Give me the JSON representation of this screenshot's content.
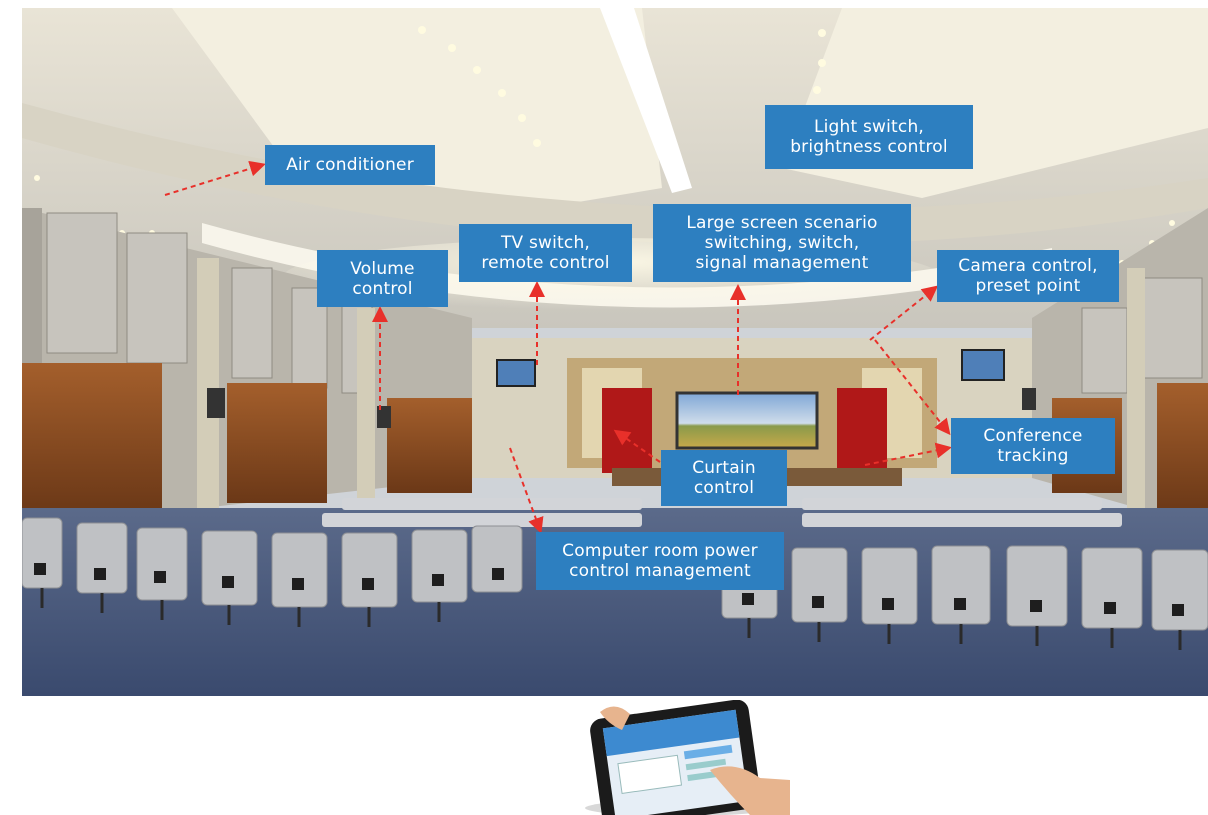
{
  "labels": {
    "air_conditioner": "Air conditioner",
    "light_switch": "Light switch,\nbrightness control",
    "tv_switch": "TV switch,\nremote control",
    "large_screen": "Large screen scenario\nswitching, switch,\nsignal management",
    "volume": "Volume\ncontrol",
    "camera": "Camera control,\npreset point",
    "conference": "Conference\ntracking",
    "curtain": "Curtain\ncontrol",
    "power": "Computer room power\ncontrol management"
  },
  "colors": {
    "label_bg": "#2d7fc0",
    "arrow": "#e8302a",
    "carpet": "#3e4f73",
    "wood": "#8a4b22",
    "curtain_red": "#b01818"
  }
}
